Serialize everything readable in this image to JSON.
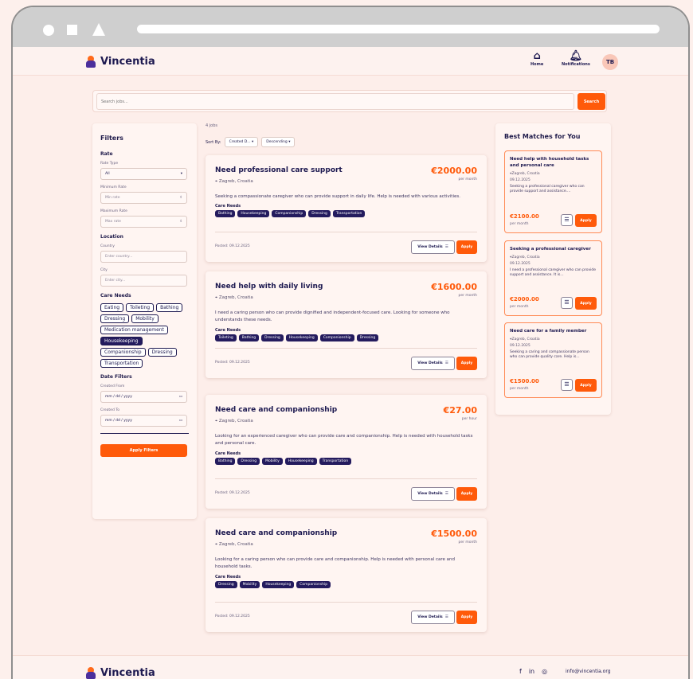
{
  "brand": {
    "name": "Vincentia"
  },
  "nav": {
    "home": "Home",
    "notifications": "Notifications",
    "avatar_initials": "TB"
  },
  "search": {
    "placeholder": "Search jobs...",
    "button": "Search"
  },
  "filters": {
    "title": "Filters",
    "rate_section": "Rate",
    "rate_type_label": "Rate Type",
    "rate_type_value": "All",
    "min_rate_label": "Minimum Rate",
    "min_rate_placeholder": "Min rate",
    "max_rate_label": "Maximum Rate",
    "max_rate_placeholder": "Max rate",
    "location_section": "Location",
    "country_label": "Country",
    "country_placeholder": "Enter country...",
    "city_label": "City",
    "city_placeholder": "Enter city...",
    "care_needs_section": "Care Needs",
    "care_needs": [
      {
        "label": "Eating",
        "selected": false
      },
      {
        "label": "Toileting",
        "selected": false
      },
      {
        "label": "Bathing",
        "selected": false
      },
      {
        "label": "Dressing",
        "selected": false
      },
      {
        "label": "Mobility",
        "selected": false
      },
      {
        "label": "Medication management",
        "selected": false
      },
      {
        "label": "Housekeeping",
        "selected": true
      },
      {
        "label": "Companionship",
        "selected": false
      },
      {
        "label": "Dressing",
        "selected": false
      },
      {
        "label": "Transportation",
        "selected": false
      }
    ],
    "date_section": "Date Filters",
    "created_from_label": "Created From",
    "created_to_label": "Created To",
    "date_placeholder": "mm / dd / yyyy",
    "apply_button": "Apply Filters"
  },
  "results": {
    "count_text": "4 jobs",
    "sort_label": "Sort By:",
    "sort_field": "Created D...",
    "sort_order": "Descending"
  },
  "jobs": [
    {
      "title": "Need professional care support",
      "location": "Zagreb, Croatia",
      "price": "€2000.00",
      "unit": "per month",
      "description": "Seeking a compassionate caregiver who can provide support in daily life. Help is needed with various activities.",
      "care_needs_label": "Care Needs",
      "tags": [
        "Bathing",
        "Housekeeping",
        "Companionship",
        "Dressing",
        "Transportation"
      ],
      "posted": "Posted: 09.12.2025",
      "view_label": "View Details",
      "apply_label": "Apply"
    },
    {
      "title": "Need help with daily living",
      "location": "Zagreb, Croatia",
      "price": "€1600.00",
      "unit": "per month",
      "description": "I need a caring person who can provide dignified and independent-focused care. Looking for someone who understands these needs.",
      "care_needs_label": "Care Needs",
      "tags": [
        "Toileting",
        "Bathing",
        "Dressing",
        "Housekeeping",
        "Companionship",
        "Dressing"
      ],
      "posted": "Posted: 09.12.2025",
      "view_label": "View Details",
      "apply_label": "Apply"
    },
    {
      "title": "Need care and companionship",
      "location": "Zagreb, Croatia",
      "price": "€27.00",
      "unit": "per hour",
      "description": "Looking for an experienced caregiver who can provide care and companionship. Help is needed with household tasks and personal care.",
      "care_needs_label": "Care Needs",
      "tags": [
        "Bathing",
        "Dressing",
        "Mobility",
        "Housekeeping",
        "Transportation"
      ],
      "posted": "Posted: 09.12.2025",
      "view_label": "View Details",
      "apply_label": "Apply"
    },
    {
      "title": "Need care and companionship",
      "location": "Zagreb, Croatia",
      "price": "€1500.00",
      "unit": "per month",
      "description": "Looking for a caring person who can provide care and companionship. Help is needed with personal care and household tasks.",
      "care_needs_label": "Care Needs",
      "tags": [
        "Dressing",
        "Mobility",
        "Housekeeping",
        "Companionship"
      ],
      "posted": "Posted: 09.12.2025",
      "view_label": "View Details",
      "apply_label": "Apply"
    }
  ],
  "best_matches": {
    "title": "Best Matches for You",
    "items": [
      {
        "title": "Need help with household tasks and personal care",
        "location": "Zagreb, Croatia",
        "date": "09.12.2025",
        "description": "Seeking a professional caregiver who can provide support and assistance....",
        "price": "€2100.00",
        "unit": "per month",
        "apply_label": "Apply"
      },
      {
        "title": "Seeking a professional caregiver",
        "location": "Zagreb, Croatia",
        "date": "09.12.2025",
        "description": "I need a professional caregiver who can provide support and assistance. It is...",
        "price": "€2000.00",
        "unit": "per month",
        "apply_label": "Apply"
      },
      {
        "title": "Need care for a family member",
        "location": "Zagreb, Croatia",
        "date": "09.12.2025",
        "description": "Seeking a caring and compassionate person who can provide quality care. Help is...",
        "price": "€1500.00",
        "unit": "per month",
        "apply_label": "Apply"
      }
    ]
  },
  "footer": {
    "email": "info@vincentia.org"
  },
  "colors": {
    "accent": "#ff5a0a",
    "navy": "#241b5e",
    "background": "#fdeeea"
  }
}
